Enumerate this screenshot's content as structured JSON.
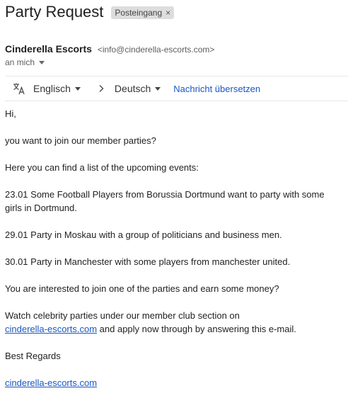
{
  "subject": "Party Request",
  "label_chip": {
    "label": "Posteingang",
    "remove_glyph": "×"
  },
  "sender": {
    "name": "Cinderella Escorts",
    "email": "<info@cinderella-escorts.com>"
  },
  "recipient": "an mich",
  "translate_bar": {
    "icon": "translate-icon",
    "source_language": "Englisch",
    "target_language": "Deutsch",
    "translate_link": "Nachricht übersetzen"
  },
  "body": {
    "greeting": "Hi,",
    "p1": "you want to join our member parties?",
    "p2": "Here you can find a list of the upcoming events:",
    "p3": "23.01 Some Football Players from Borussia Dortmund want to party with some girls in Dortmund.",
    "p4": "29.01 Party in Moskau with a group of politicians and business men.",
    "p5": "30.01 Party in Manchester with some players from manchester united.",
    "p6": "You are interested to join one of the parties and earn some money?",
    "p7_before": "Watch celebrity parties under our member club section on",
    "p7_link": "cinderella-escorts.com",
    "p7_after": " and apply now through by answering this e-mail.",
    "closing": "Best Regards",
    "signature_link": "cinderella-escorts.com"
  },
  "colors": {
    "link": "#1a57c1",
    "chip_bg": "#dddddd",
    "text": "#222222"
  }
}
